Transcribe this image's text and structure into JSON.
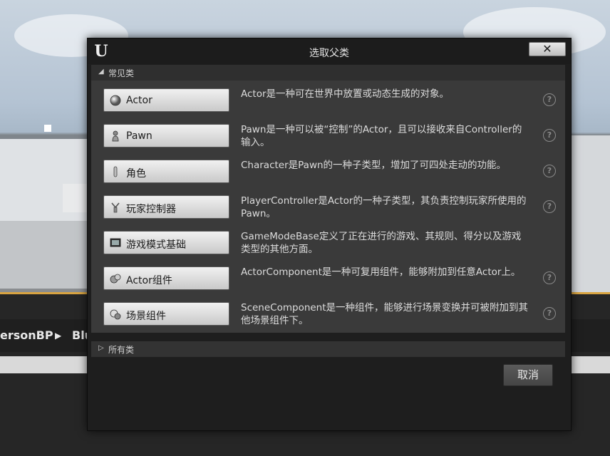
{
  "background": {
    "breadcrumb_left": "ersonBP",
    "breadcrumb_right": "Blu",
    "breadcrumb_sep": "▶"
  },
  "dialog": {
    "title": "选取父类",
    "close_label": "✕",
    "common_section": {
      "label": "常见类",
      "arrow": "◢",
      "classes": [
        {
          "name": "Actor",
          "icon": "sphere-icon",
          "description": "Actor是一种可在世界中放置或动态生成的对象。",
          "has_help": true
        },
        {
          "name": "Pawn",
          "icon": "pawn-icon",
          "description": "Pawn是一种可以被“控制”的Actor，且可以接收来自Controller的输入。",
          "has_help": true
        },
        {
          "name": "角色",
          "icon": "character-icon",
          "description": "Character是Pawn的一种子类型，增加了可四处走动的功能。",
          "has_help": true
        },
        {
          "name": "玩家控制器",
          "icon": "player-controller-icon",
          "description": "PlayerController是Actor的一种子类型，其负责控制玩家所使用的Pawn。",
          "has_help": true
        },
        {
          "name": "游戏模式基础",
          "icon": "game-mode-icon",
          "description": "GameModeBase定义了正在进行的游戏、其规则、得分以及游戏类型的其他方面。",
          "has_help": false
        },
        {
          "name": "Actor组件",
          "icon": "actor-component-icon",
          "description": "ActorComponent是一种可复用组件，能够附加到任意Actor上。",
          "has_help": true
        },
        {
          "name": "场景组件",
          "icon": "scene-component-icon",
          "description": "SceneComponent是一种组件，能够进行场景变换并可被附加到其他场景组件下。",
          "has_help": true
        }
      ]
    },
    "all_section": {
      "label": "所有类",
      "arrow": "▷"
    },
    "cancel_label": "取消",
    "help_glyph": "?"
  }
}
